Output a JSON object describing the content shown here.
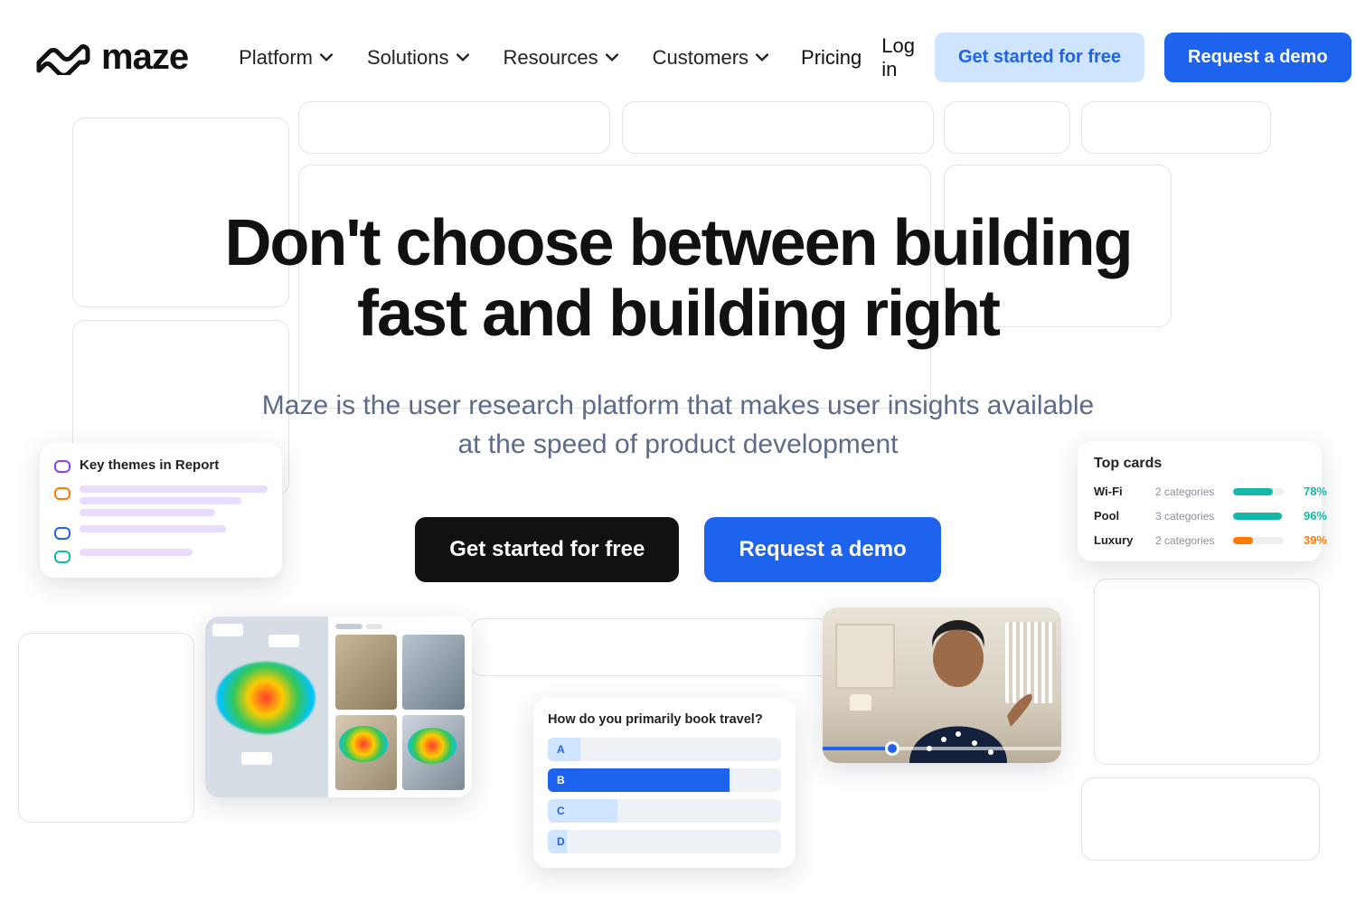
{
  "brand": {
    "name": "maze"
  },
  "nav": {
    "items": [
      "Platform",
      "Solutions",
      "Resources",
      "Customers"
    ],
    "pricing": "Pricing",
    "login": "Log in",
    "cta_free": "Get started for free",
    "cta_demo": "Request a demo"
  },
  "hero": {
    "headline": "Don't choose between building fast and building right",
    "subtitle": "Maze is the user research platform that makes user insights available at the speed of product development",
    "cta_free": "Get started for free",
    "cta_demo": "Request a demo"
  },
  "themes_card": {
    "title": "Key themes in Report",
    "chips": [
      {
        "id": "chip-purple",
        "color": "#8a3ffc"
      },
      {
        "id": "chip-orange",
        "color": "#ff7a00"
      },
      {
        "id": "chip-blue",
        "color": "#1d63ed"
      },
      {
        "id": "chip-teal",
        "color": "#14b8a6"
      }
    ]
  },
  "top_cards": {
    "title": "Top cards",
    "rows": [
      {
        "name": "Wi-Fi",
        "categories": "2 categories",
        "pct": 78,
        "color": "#14b8a6"
      },
      {
        "name": "Pool",
        "categories": "3 categories",
        "pct": 96,
        "color": "#14b8a6"
      },
      {
        "name": "Luxury",
        "categories": "2 categories",
        "pct": 39,
        "color": "#ff7a00"
      }
    ]
  },
  "survey": {
    "question": "How do you primarily book travel?",
    "options": [
      {
        "letter": "A",
        "fill_pct": 14,
        "fill_color": "#cfe4ff",
        "text_color": "#1d63ed"
      },
      {
        "letter": "B",
        "fill_pct": 78,
        "fill_color": "#1d63ed",
        "text_color": "#ffffff"
      },
      {
        "letter": "C",
        "fill_pct": 30,
        "fill_color": "#cfe4ff",
        "text_color": "#1d63ed"
      },
      {
        "letter": "D",
        "fill_pct": 8,
        "fill_color": "#cfe4ff",
        "text_color": "#1d63ed"
      }
    ]
  },
  "colors": {
    "blue": "#1d63ed",
    "lightblue": "#cfe4ff",
    "teal": "#14b8a6",
    "orange": "#ff7a00",
    "text_muted": "#5c6b8a"
  }
}
